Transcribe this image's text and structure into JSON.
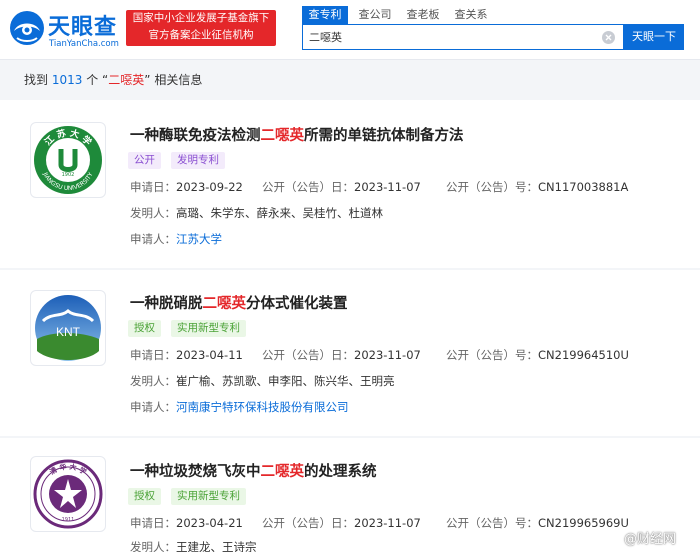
{
  "header": {
    "logo": {
      "name_cn": "天眼查",
      "name_en": "TianYanCha.com"
    },
    "slogan": {
      "line1": "国家中小企业发展子基金旗下",
      "line2": "官方备案企业征信机构"
    },
    "tabs": [
      {
        "label": "查专利",
        "active": true
      },
      {
        "label": "查公司",
        "active": false
      },
      {
        "label": "查老板",
        "active": false
      },
      {
        "label": "查关系",
        "active": false
      }
    ],
    "search": {
      "value": "二噁英",
      "button": "天眼一下"
    }
  },
  "summary": {
    "prefix": "找到",
    "count": "1013",
    "middle": "个 “",
    "keyword": "二噁英",
    "suffix": "” 相关信息"
  },
  "results": [
    {
      "title_pre": "一种酶联免疫法检测",
      "title_hl": "二噁英",
      "title_post": "所需的单链抗体制备方法",
      "status_tag": "公开",
      "type_tag": "发明专利",
      "apply_label": "申请日：",
      "apply_date": "2023-09-22",
      "pub_label": "公开（公告）日：",
      "pub_date": "2023-11-07",
      "pubno_label": "公开（公告）号：",
      "pub_no": "CN117003881A",
      "inventor_label": "发明人：",
      "inventors": "高璐、朱学东、薛永来、吴桂竹、杜道林",
      "applicant_label": "申请人：",
      "applicant": "江苏大学",
      "logo_text": "JIANGSU UNIVERSITY",
      "logo_year": "1902",
      "logo_cn": "江 苏 大 学"
    },
    {
      "title_pre": "一种脱硝脱",
      "title_hl": "二噁英",
      "title_post": "分体式催化装置",
      "status_tag": "授权",
      "type_tag": "实用新型专利",
      "apply_label": "申请日：",
      "apply_date": "2023-04-11",
      "pub_label": "公开（公告）日：",
      "pub_date": "2023-11-07",
      "pubno_label": "公开（公告）号：",
      "pub_no": "CN219964510U",
      "inventor_label": "发明人：",
      "inventors": "崔广榆、苏凯歌、申李阳、陈兴华、王明亮",
      "applicant_label": "申请人：",
      "applicant": "河南康宁特环保科技股份有限公司",
      "logo_text": "KNT"
    },
    {
      "title_pre": "一种垃圾焚烧飞灰中",
      "title_hl": "二噁英",
      "title_post": "的处理系统",
      "status_tag": "授权",
      "type_tag": "实用新型专利",
      "apply_label": "申请日：",
      "apply_date": "2023-04-21",
      "pub_label": "公开（公告）日：",
      "pub_date": "2023-11-07",
      "pubno_label": "公开（公告）号：",
      "pub_no": "CN219965969U",
      "inventor_label": "发明人：",
      "inventors": "王建龙、王诗宗",
      "logo_year": "1911",
      "logo_cn": "清 华 大 学"
    }
  ],
  "watermark": "@财经网",
  "colors": {
    "brand_blue": "#0a6cd8",
    "highlight_red": "#e4272a",
    "tag_purple": "#8a4fd1",
    "tag_green": "#4aa236"
  }
}
